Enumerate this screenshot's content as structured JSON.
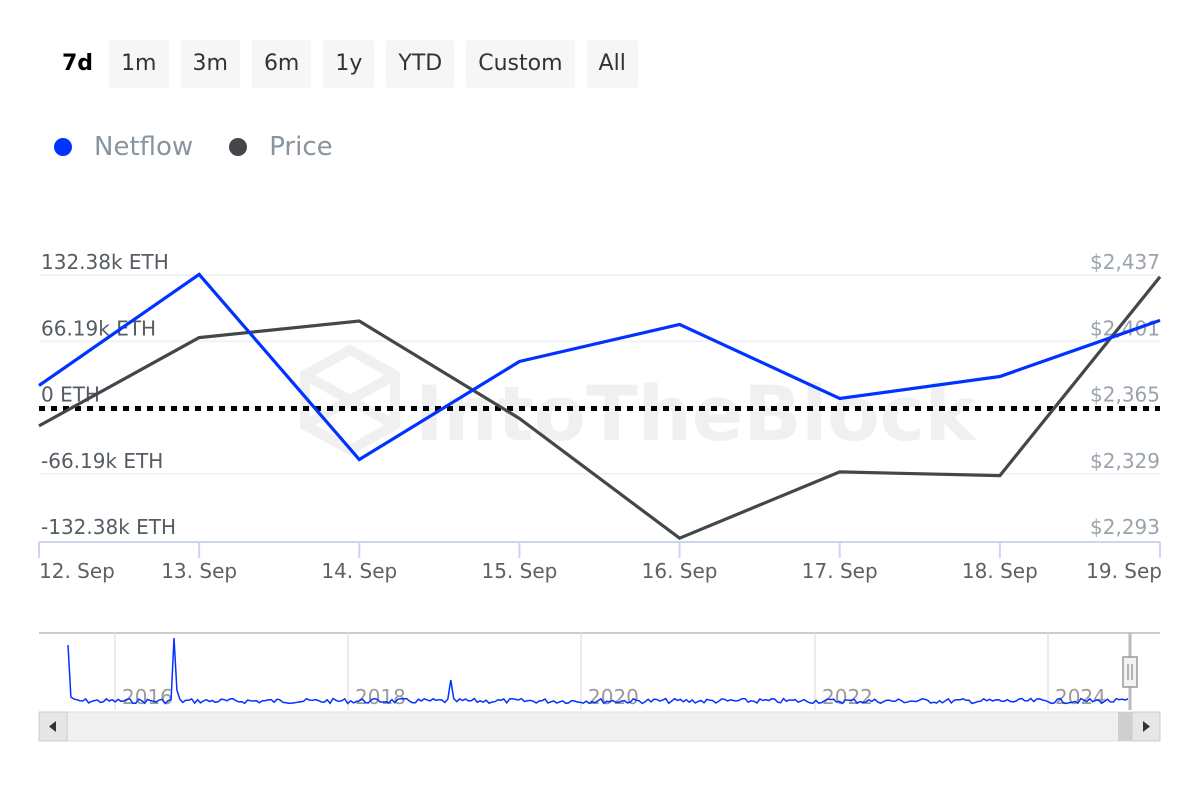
{
  "range_selector": {
    "active": "7d",
    "buttons": [
      "7d",
      "1m",
      "3m",
      "6m",
      "1y",
      "YTD",
      "Custom",
      "All"
    ]
  },
  "legend": [
    {
      "label": "Netflow",
      "color": "#0033ff"
    },
    {
      "label": "Price",
      "color": "#43474c"
    }
  ],
  "watermark": "IntoTheBlock",
  "chart_data": {
    "type": "line",
    "title": "",
    "xlabel": "",
    "categories": [
      "12. Sep",
      "13. Sep",
      "14. Sep",
      "15. Sep",
      "16. Sep",
      "17. Sep",
      "18. Sep",
      "19. Sep"
    ],
    "series": [
      {
        "name": "Netflow",
        "axis": "left",
        "unit": "ETH",
        "color": "#0033ff",
        "values": [
          22000,
          133000,
          -52000,
          46000,
          83000,
          9000,
          31000,
          87000
        ]
      },
      {
        "name": "Price",
        "axis": "right",
        "unit": "USD",
        "color": "#43474c",
        "values": [
          2355,
          2403,
          2412,
          2359,
          2294,
          2330,
          2328,
          2436
        ]
      }
    ],
    "y_left": {
      "ticks": [
        132380,
        66190,
        0,
        -66190,
        -132380
      ],
      "tick_labels": [
        "132.38k ETH",
        "66.19k ETH",
        "0 ETH",
        "-66.19k ETH",
        "-132.38k ETH"
      ],
      "ylim": [
        -132380,
        132380
      ]
    },
    "y_right": {
      "ticks": [
        2437,
        2401,
        2365,
        2329,
        2293
      ],
      "tick_labels": [
        "$2,437",
        "$2,401",
        "$2,365",
        "$2,329",
        "$2,293"
      ],
      "ylim": [
        2293,
        2437
      ]
    },
    "zero_line": {
      "value": 0,
      "style": "dotted",
      "color": "#000000"
    },
    "grid": true,
    "legend_position": "top-left",
    "navigator": {
      "year_labels": [
        "2016",
        "2018",
        "2020",
        "2022",
        "2024"
      ],
      "series_color": "#0033ff"
    }
  }
}
